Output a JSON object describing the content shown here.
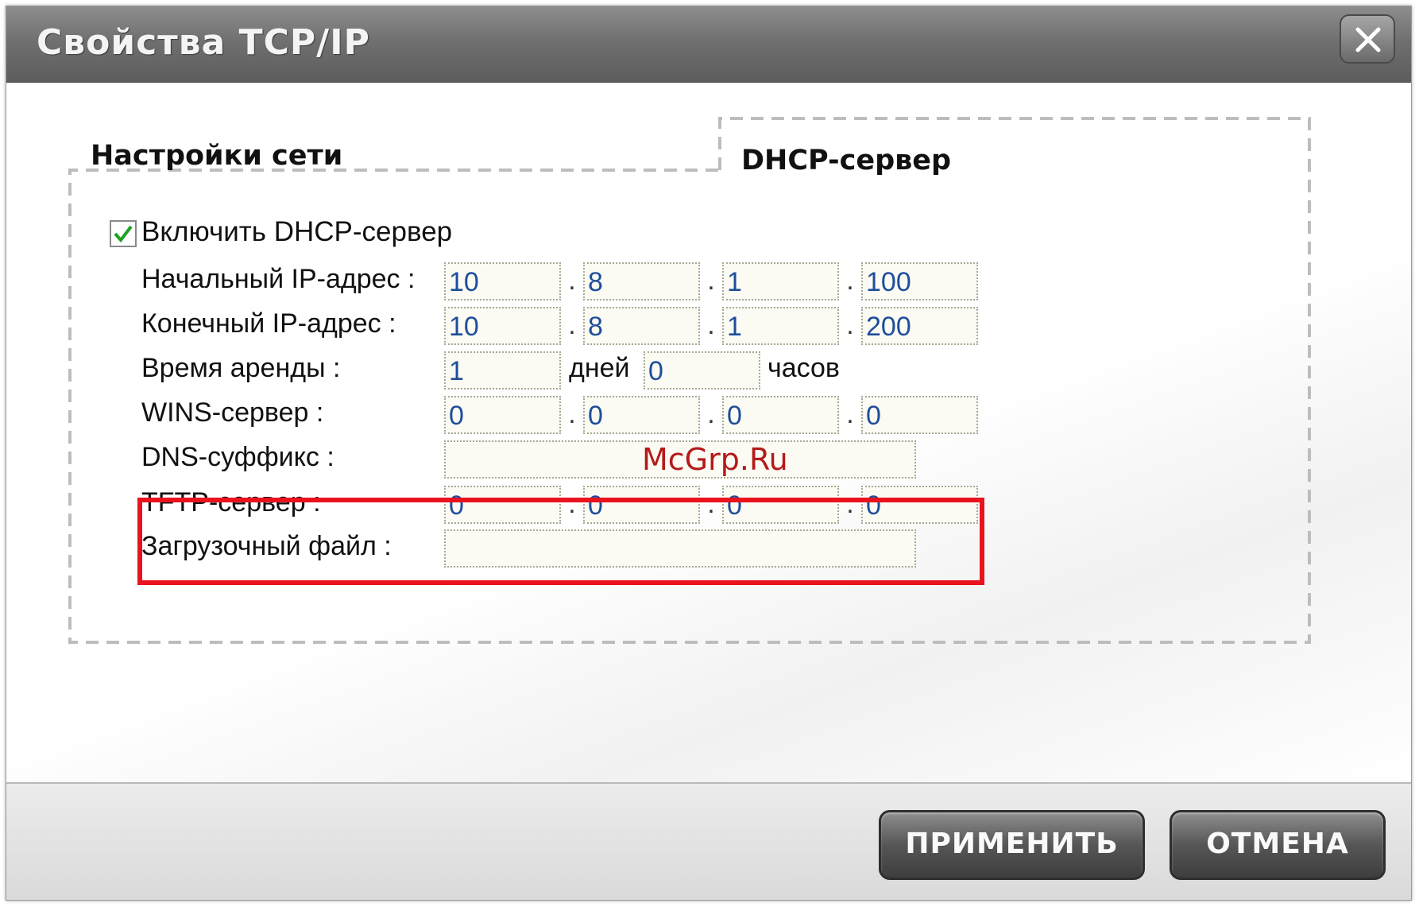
{
  "window": {
    "title": "Свойства TCP/IP",
    "close_label": "X"
  },
  "tabs": [
    {
      "label": "Настройки сети",
      "active": false
    },
    {
      "label": "DHCP-сервер",
      "active": true
    }
  ],
  "dhcp": {
    "enable_label": "Включить DHCP-сервер",
    "enable_checked": true,
    "start_ip": {
      "label": "Начальный IP-адрес :",
      "octets": [
        "10",
        "8",
        "1",
        "100"
      ]
    },
    "end_ip": {
      "label": "Конечный IP-адрес :",
      "octets": [
        "10",
        "8",
        "1",
        "200"
      ]
    },
    "lease": {
      "label": "Время аренды :",
      "days": "1",
      "days_unit": "дней",
      "hours": "0",
      "hours_unit": "часов"
    },
    "wins": {
      "label": "WINS-сервер :",
      "octets": [
        "0",
        "0",
        "0",
        "0"
      ]
    },
    "dns_suffix": {
      "label": "DNS-суффикс :",
      "value": ""
    },
    "tftp": {
      "label": "TFTP-сервер :",
      "octets": [
        "0",
        "0",
        "0",
        "0"
      ]
    },
    "boot_file": {
      "label": "Загрузочный файл :",
      "value": ""
    },
    "octet_separator": "."
  },
  "watermark": "McGrp.Ru",
  "highlight_color": "#e8131d",
  "buttons": {
    "apply": "ПРИМЕНИТЬ",
    "cancel": "ОТМЕНА"
  }
}
